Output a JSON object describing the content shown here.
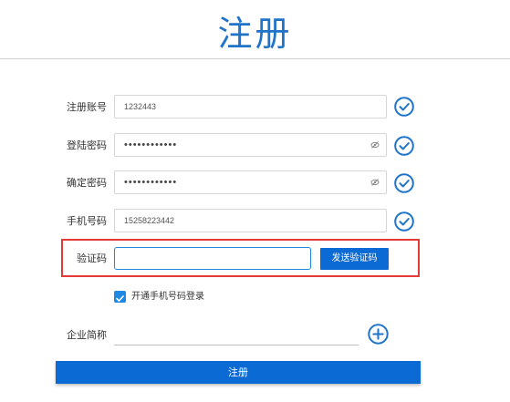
{
  "page": {
    "title": "注册",
    "accent_color": "#0b6ad4",
    "highlight_color": "#e53935"
  },
  "form": {
    "account": {
      "label": "注册账号",
      "value": "1232443",
      "valid_icon": "check-circle-icon"
    },
    "password": {
      "label": "登陆密码",
      "value": "••••••••••••",
      "toggle_icon": "eye-slash-icon",
      "valid_icon": "check-circle-icon"
    },
    "confirm_password": {
      "label": "确定密码",
      "value": "••••••••••••",
      "toggle_icon": "eye-slash-icon",
      "valid_icon": "check-circle-icon"
    },
    "phone": {
      "label": "手机号码",
      "value": "15258223442",
      "valid_icon": "check-circle-icon"
    },
    "verify_code": {
      "label": "验证码",
      "value": "",
      "send_button": "发送验证码"
    },
    "phone_login_option": {
      "label": "开通手机号码登录",
      "checked": true
    },
    "company": {
      "label": "企业简称",
      "value": "",
      "add_icon": "plus-circle-icon"
    },
    "submit_label": "注册"
  }
}
